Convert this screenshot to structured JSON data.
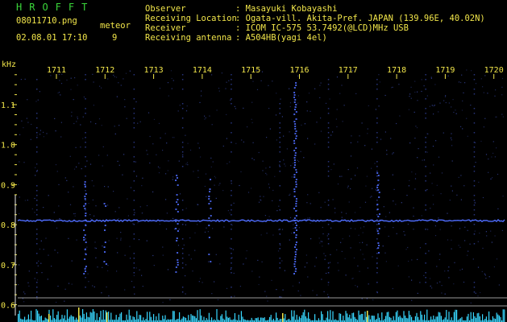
{
  "header": {
    "logo": "HROFFT",
    "file_name": "08011710.png",
    "date_time": "02.08.01 17:10",
    "meteor_label": "meteor",
    "meteor_count": "9",
    "fields": [
      {
        "label": "Observer",
        "value": ": Masayuki Kobayashi"
      },
      {
        "label": "Receiving Location",
        "value": ": Ogata-vill. Akita-Pref. JAPAN (139.96E, 40.02N)"
      },
      {
        "label": "Receiver",
        "value": ": ICOM IC-575 53.7492(@LCD)MHz USB"
      },
      {
        "label": "Receiving antenna",
        "value": ": A504HB(yagi 4el)"
      }
    ]
  },
  "spectrogram": {
    "y_unit": "kHz",
    "y_ticks": [
      "1.1",
      "1.0",
      "0.9",
      "0.8",
      "0.7",
      "0.6"
    ],
    "time_ticks": [
      "1711",
      "1712",
      "1713",
      "1714",
      "1715",
      "1716",
      "1717",
      "1718",
      "1719",
      "1720"
    ],
    "carrier_khz": 0.81,
    "colors": {
      "background": "#000000",
      "signal": "#4f6dff",
      "axis": "#f2e64a",
      "bars": "#38d7ff"
    }
  }
}
